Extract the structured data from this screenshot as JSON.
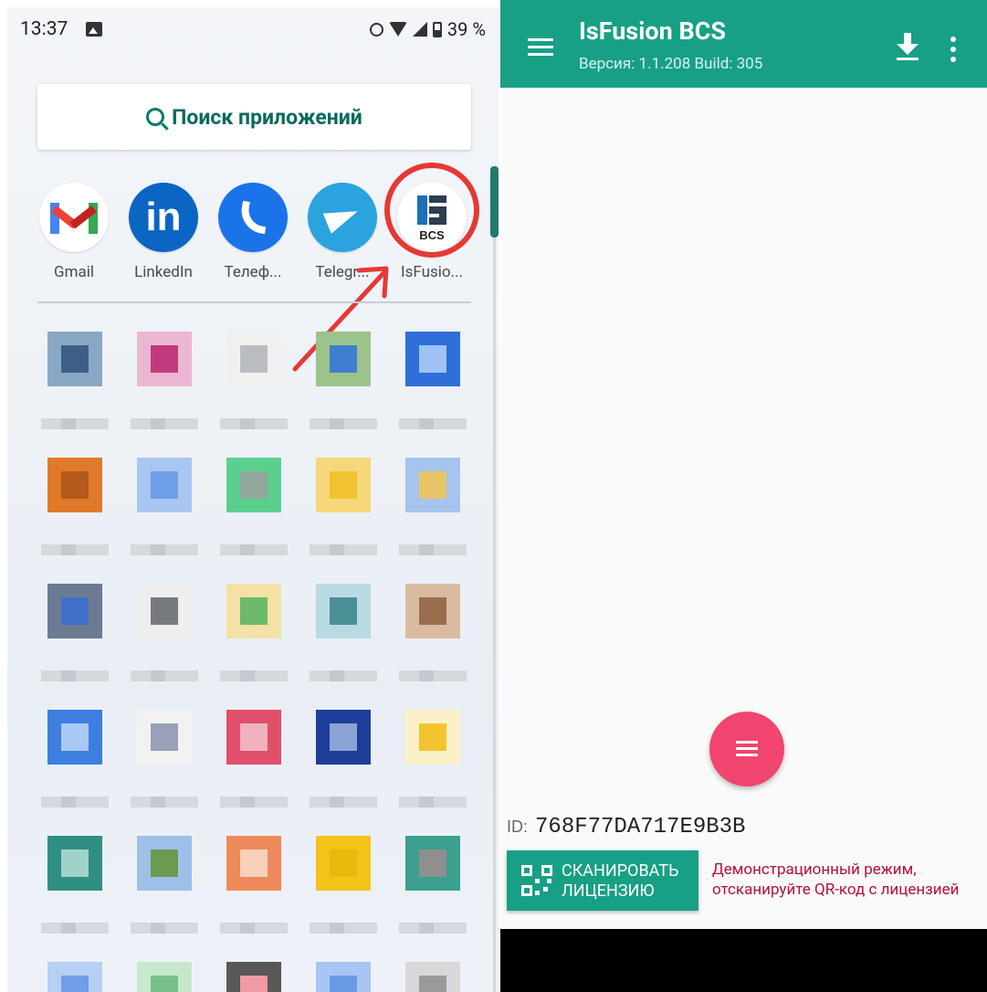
{
  "launcher": {
    "status_time": "13:37",
    "battery_percent": "39 %",
    "search_label": "Поиск приложений",
    "apps": [
      {
        "label": "Gmail"
      },
      {
        "label": "LinkedIn"
      },
      {
        "label": "Телеф..."
      },
      {
        "label": "Telegr..."
      },
      {
        "label": "IsFusio...",
        "icon_text": "BCS"
      }
    ],
    "highlight_color": "#e53935"
  },
  "app": {
    "title": "IsFusion BCS",
    "subtitle": "Версия: 1.1.208 Build: 305",
    "primary_color": "#17a086",
    "fab_color": "#f1446f",
    "id_label": "ID:",
    "id_value": "768F77DA717E9B3B",
    "scan_button_line1": "СКАНИРОВАТЬ",
    "scan_button_line2": "ЛИЦЕНЗИЮ",
    "demo_line1": "Демонстрационный режим,",
    "demo_line2": "отсканируйте QR-код с лицензией"
  }
}
